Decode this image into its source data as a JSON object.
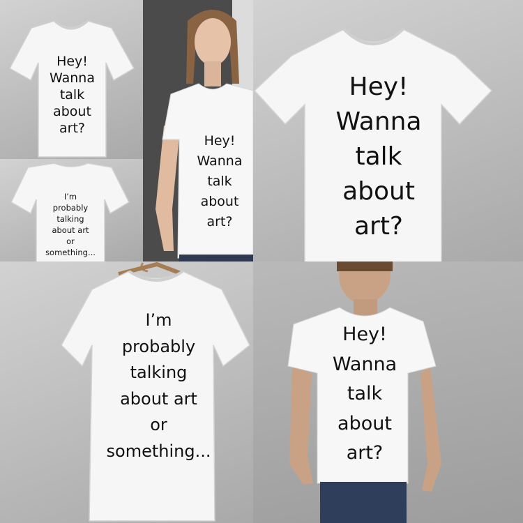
{
  "panels": [
    {
      "id": "flat-front",
      "subject": "t-shirt-front",
      "print_lines": [
        "Hey!",
        "Wanna",
        "talk",
        "about",
        "art?"
      ]
    },
    {
      "id": "flat-back",
      "subject": "t-shirt-back",
      "print_lines": [
        "I’m",
        "probably",
        "talking",
        "about art",
        "or",
        "something..."
      ]
    },
    {
      "id": "woman-model",
      "subject": "woman-wearing-t-shirt",
      "print_lines": [
        "Hey!",
        "Wanna",
        "talk",
        "about",
        "art?"
      ]
    },
    {
      "id": "closeup-front",
      "subject": "t-shirt-front-closeup",
      "print_lines": [
        "Hey!",
        "Wanna",
        "talk",
        "about",
        "art?"
      ]
    },
    {
      "id": "hanger-shirt",
      "subject": "t-shirt-on-hanger",
      "print_lines": [
        "I’m",
        "probably",
        "talking",
        "about art",
        "or",
        "something..."
      ]
    },
    {
      "id": "man-model",
      "subject": "man-wearing-t-shirt",
      "print_lines": [
        "Hey!",
        "Wanna",
        "talk",
        "about",
        "art?"
      ]
    }
  ],
  "colors": {
    "shirt": "#f7f7f7",
    "print": "#111111",
    "backdrop_light": "#c4c4c4",
    "backdrop_dark": "#4b4b4b"
  }
}
